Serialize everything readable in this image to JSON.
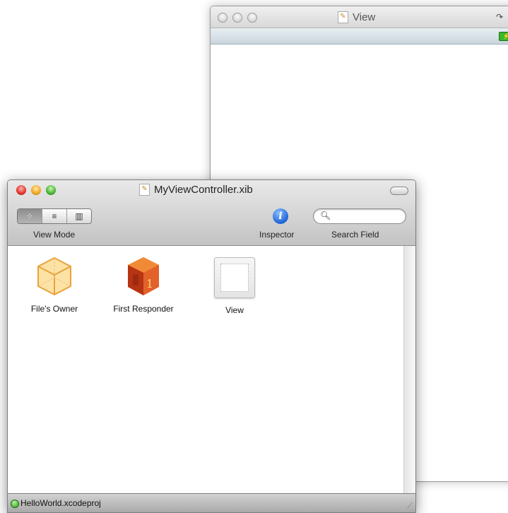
{
  "view_window": {
    "title": "View",
    "title_icon": "document-icon",
    "status_icon": "battery-charging-icon"
  },
  "xib_window": {
    "title": "MyViewController.xib",
    "title_icon": "document-icon",
    "toolbar": {
      "view_mode_label": "View Mode",
      "view_mode_options": [
        "icon-view",
        "list-view",
        "column-view"
      ],
      "view_mode_selected": "icon-view",
      "inspector_label": "Inspector",
      "inspector_glyph": "i",
      "search_label": "Search Field",
      "search_value": ""
    },
    "objects": [
      {
        "label": "File's Owner",
        "icon": "cube-icon"
      },
      {
        "label": "First Responder",
        "icon": "first-responder-icon",
        "badge": "1"
      },
      {
        "label": "View",
        "icon": "view-icon"
      }
    ],
    "status": {
      "project": "HelloWorld.xcodeproj",
      "indicator_color": "#2b9c16"
    }
  }
}
